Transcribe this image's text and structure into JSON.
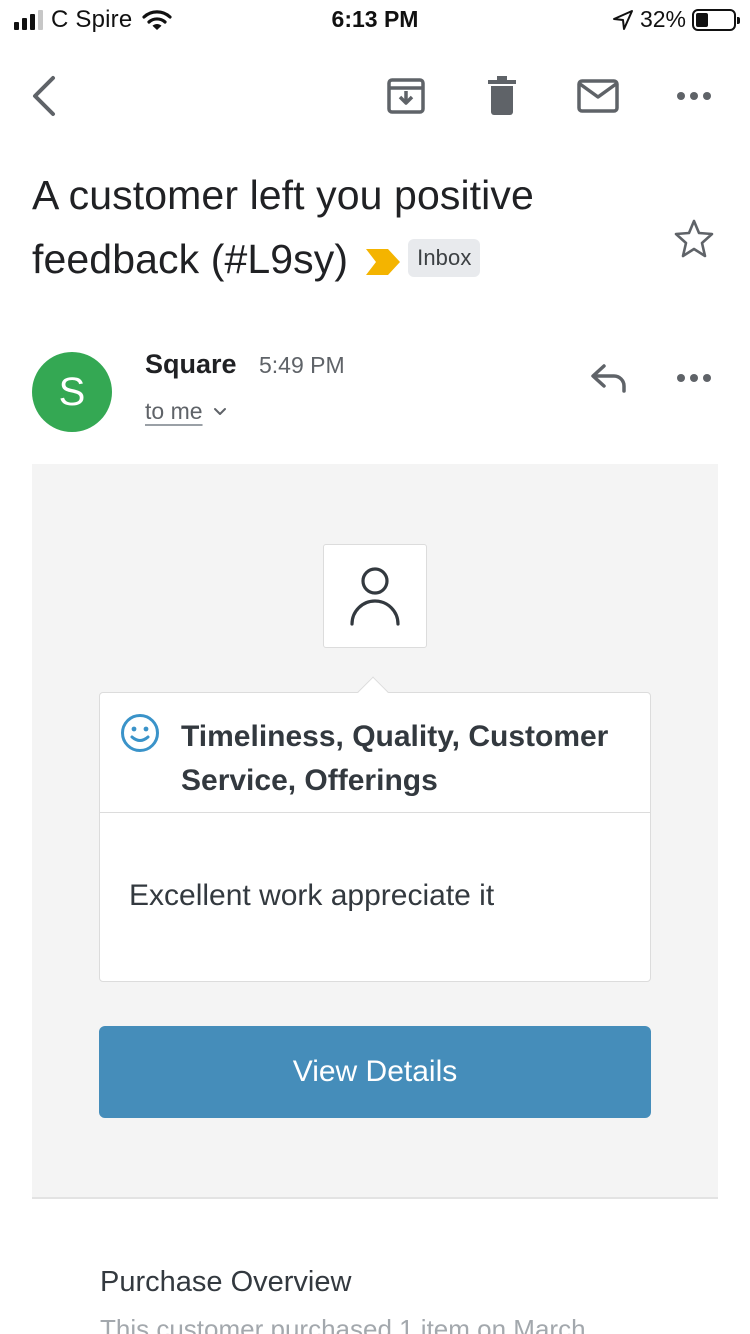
{
  "status_bar": {
    "carrier": "C Spire",
    "time": "6:13 PM",
    "battery": "32%",
    "battery_level": 0.32,
    "icons": [
      "signal-icon",
      "wifi-icon",
      "location-arrow-icon",
      "battery-icon"
    ]
  },
  "toolbar": {
    "icons": [
      "back-arrow-icon",
      "archive-icon",
      "trash-icon",
      "mark-unread-icon",
      "more-horizontal-icon"
    ]
  },
  "email": {
    "subject": "A customer left you positive feedback (#L9sy)",
    "label_chip": "Inbox",
    "importance_color": "#f4b400",
    "starred": false
  },
  "sender": {
    "avatar_letter": "S",
    "avatar_color": "#34a853",
    "name": "Square",
    "time": "5:49 PM",
    "recipient": "to me"
  },
  "body": {
    "feedback_categories": "Timeliness, Quality, Customer Service, Offerings",
    "comment": "Excellent work appreciate it",
    "button_label": "View Details",
    "button_color": "#458dba",
    "section_title": "Purchase Overview",
    "section_text": "This customer purchased 1 item on March"
  }
}
